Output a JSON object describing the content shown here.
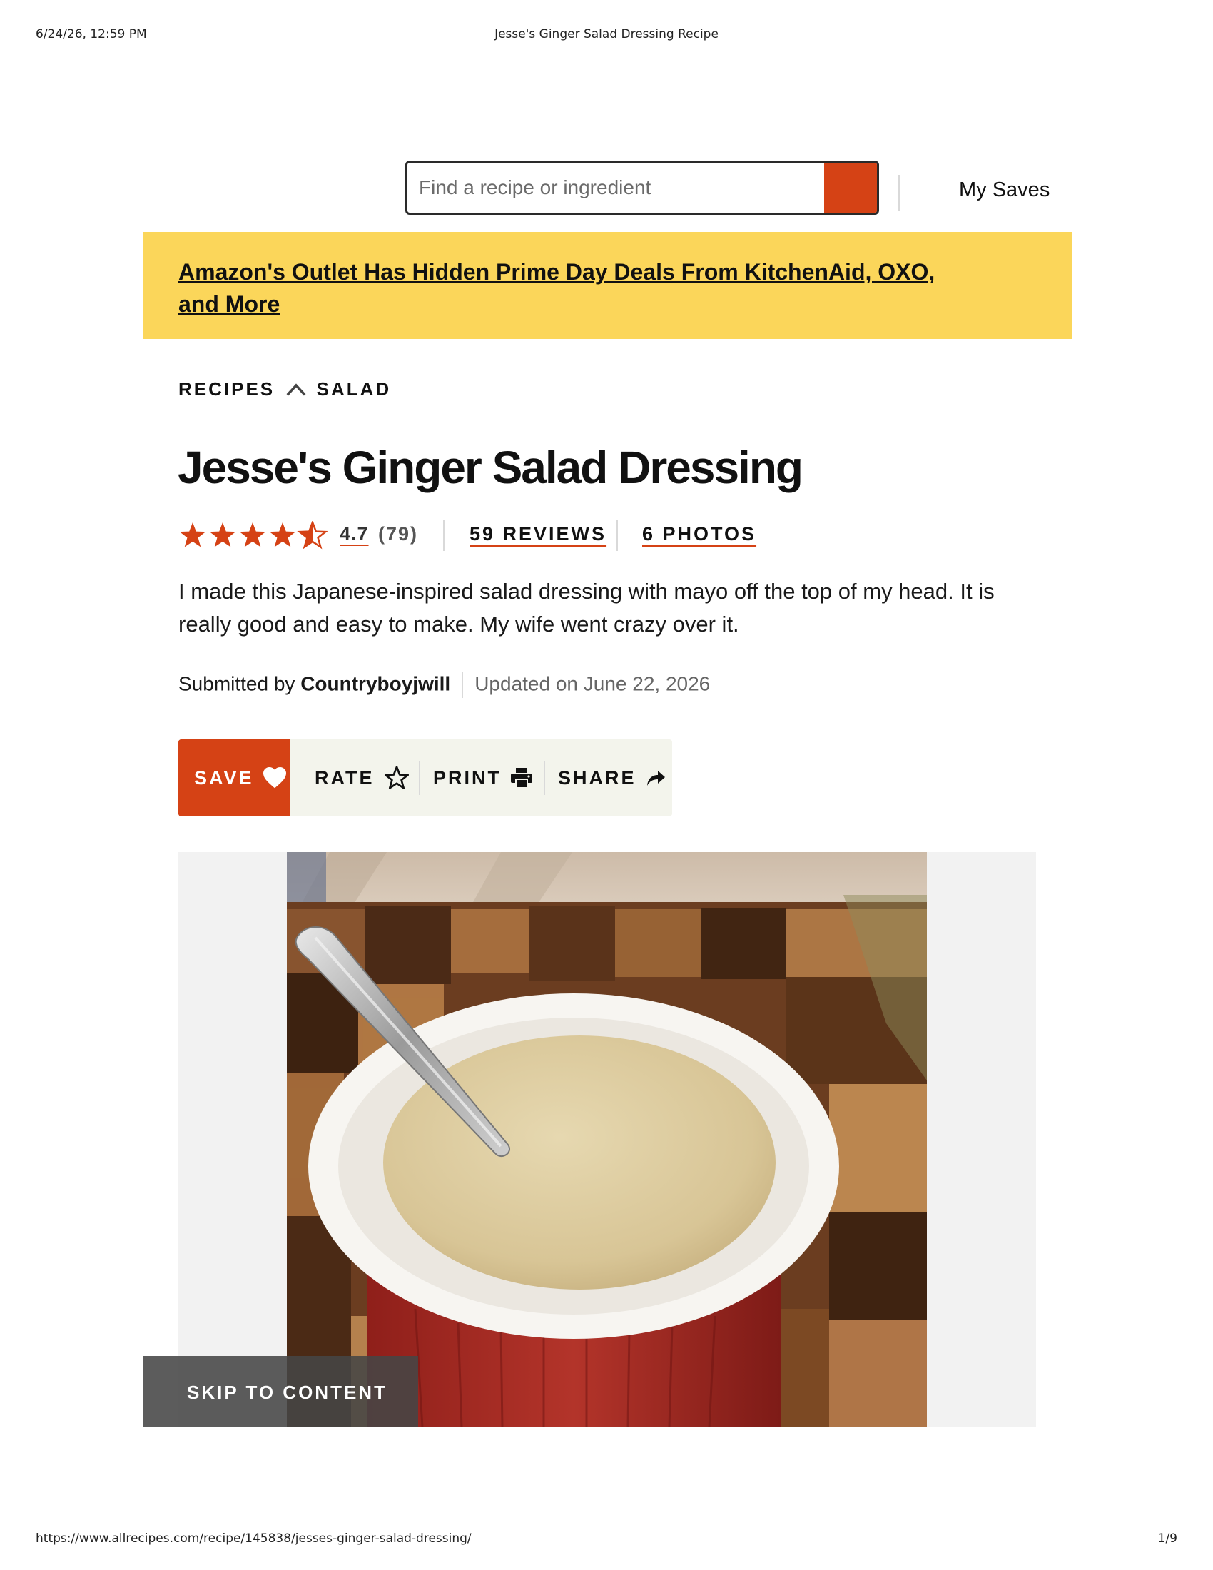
{
  "print_header": {
    "datetime": "6/24/26, 12:59 PM",
    "title": "Jesse's Ginger Salad Dressing Recipe"
  },
  "print_footer": {
    "url": "https://www.allrecipes.com/recipe/145838/jesses-ginger-salad-dressing/",
    "page": "1/9"
  },
  "header": {
    "search_placeholder": "Find a recipe or ingredient",
    "my_saves": "My Saves"
  },
  "promo": {
    "text": "Amazon's Outlet Has Hidden Prime Day Deals From KitchenAid, OXO, and More",
    "color": "#fbd65a"
  },
  "breadcrumb": {
    "items": [
      "RECIPES",
      "SALAD"
    ]
  },
  "recipe": {
    "title": "Jesse's Ginger Salad Dressing",
    "rating_value": "4.7",
    "rating_count": "(79)",
    "stars": 4.7,
    "reviews_label": "59 REVIEWS",
    "photos_label": "6 PHOTOS",
    "description": "I made this Japanese-inspired salad dressing with mayo off the top of my head. It is really good and easy to make. My wife went crazy over it.",
    "submitted_by_label": "Submitted by",
    "author": "Countryboyjwill",
    "updated": "Updated on June 22, 2026"
  },
  "actions": {
    "save": "SAVE",
    "rate": "RATE",
    "print": "PRINT",
    "share": "SHARE"
  },
  "skip_to_content": "SKIP TO CONTENT",
  "colors": {
    "accent": "#d54215",
    "action_bar_bg": "#f3f4ec"
  },
  "icons": [
    "search-icon",
    "chevron-up-icon",
    "star-icon",
    "heart-icon",
    "star-outline-icon",
    "printer-icon",
    "share-arrow-icon"
  ]
}
